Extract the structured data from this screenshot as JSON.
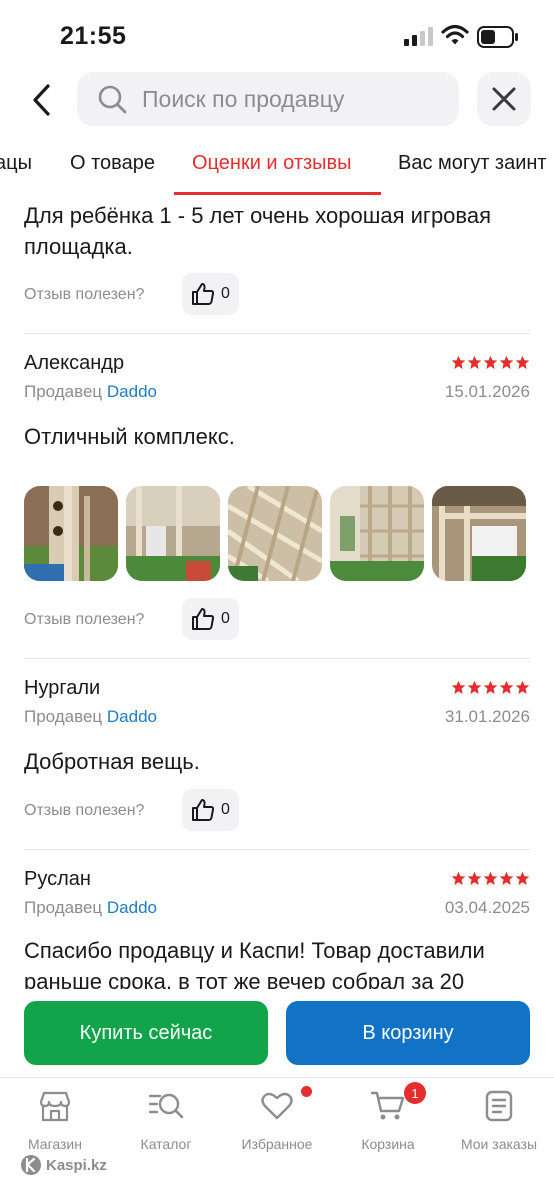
{
  "status_bar": {
    "time": "21:55"
  },
  "header": {
    "search_placeholder": "Поиск по продавцу"
  },
  "tabs": [
    "ацы",
    "О товаре",
    "Оценки и отзывы",
    "Вас могут заинт"
  ],
  "active_tab": "Оценки и отзывы",
  "helpful_label": "Отзыв полезен?",
  "seller_prefix": "Продавец",
  "reviews": [
    {
      "text": "Для ребёнка 1 - 5 лет очень хорошая игровая площадка.",
      "likes": "0"
    },
    {
      "author": "Александр",
      "seller": "Daddo",
      "rating": 5,
      "date": "15.01.2026",
      "text": "Отличный комплекс.",
      "photos": 5,
      "likes": "0"
    },
    {
      "author": "Нургали",
      "seller": "Daddo",
      "rating": 5,
      "date": "31.01.2026",
      "text": "Добротная вещь.",
      "likes": "0"
    },
    {
      "author": "Руслан",
      "seller": "Daddo",
      "rating": 5,
      "date": "03.04.2025",
      "text": "Спасибо продавцу и Каспи! Товар доставили раньше срока, в тот же вечер собрал за 20"
    }
  ],
  "actions": {
    "buy_now": "Купить сейчас",
    "add_to_cart": "В корзину"
  },
  "nav": [
    {
      "label": "Магазин",
      "icon": "store-icon"
    },
    {
      "label": "Каталог",
      "icon": "catalog-search-icon"
    },
    {
      "label": "Избранное",
      "icon": "heart-icon",
      "dot": true
    },
    {
      "label": "Корзина",
      "icon": "cart-icon",
      "badge": "1"
    },
    {
      "label": "Мои заказы",
      "icon": "orders-icon"
    }
  ],
  "brand": "Kaspi.kz",
  "colors": {
    "accent_red": "#e52d2d",
    "buy_green": "#11a44a",
    "cart_blue": "#1272c6",
    "seller_link": "#1d7bc5",
    "star": "#e52d2d"
  }
}
